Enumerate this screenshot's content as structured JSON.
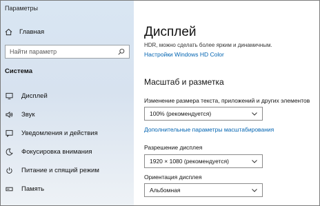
{
  "window": {
    "title": "Параметры"
  },
  "sidebar": {
    "home_label": "Главная",
    "search_placeholder": "Найти параметр",
    "section_title": "Система",
    "items": [
      {
        "label": "Дисплей",
        "icon": "monitor-icon"
      },
      {
        "label": "Звук",
        "icon": "speaker-icon"
      },
      {
        "label": "Уведомления и действия",
        "icon": "notification-icon"
      },
      {
        "label": "Фокусировка внимания",
        "icon": "moon-icon"
      },
      {
        "label": "Питание и спящий режим",
        "icon": "power-icon"
      },
      {
        "label": "Память",
        "icon": "storage-icon"
      }
    ]
  },
  "main": {
    "title": "Дисплей",
    "hdr_text": "HDR, можно сделать более ярким и динамичным.",
    "hdr_link": "Настройки Windows HD Color",
    "scale_heading": "Масштаб и разметка",
    "scale_label": "Изменение размера текста, приложений и других элементов",
    "scale_value": "100% (рекомендуется)",
    "scale_advanced_link": "Дополнительные параметры масштабирования",
    "resolution_label": "Разрешение дисплея",
    "resolution_value": "1920 × 1080 (рекомендуется)",
    "orientation_label": "Ориентация дисплея",
    "orientation_value": "Альбомная"
  },
  "colors": {
    "accent_link": "#0063b1",
    "sidebar_bg": "#d9e6f3"
  }
}
